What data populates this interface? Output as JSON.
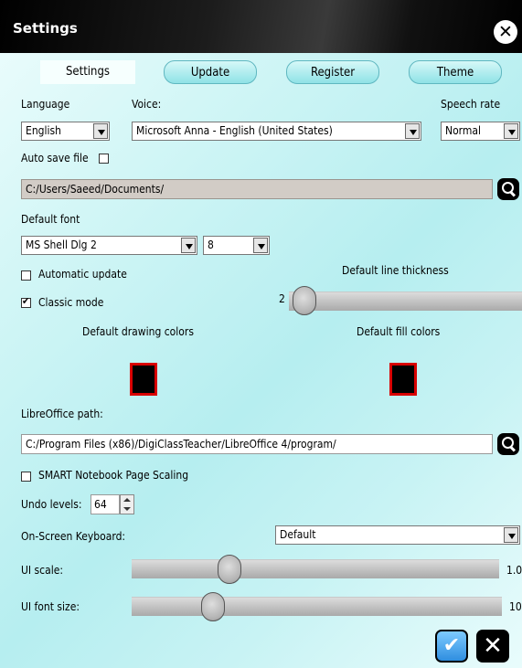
{
  "window": {
    "title": "Settings"
  },
  "tabs": [
    {
      "label": "Settings",
      "active": true
    },
    {
      "label": "Update",
      "active": false
    },
    {
      "label": "Register",
      "active": false
    },
    {
      "label": "Theme",
      "active": false
    }
  ],
  "language": {
    "label": "Language",
    "value": "English"
  },
  "voice": {
    "label": "Voice:",
    "value": "Microsoft Anna - English (United States)"
  },
  "speech_rate": {
    "label": "Speech rate",
    "value": "Normal"
  },
  "autosave": {
    "label": "Auto save file",
    "checked": false,
    "path": "C:/Users/Saeed/Documents/"
  },
  "default_font": {
    "label": "Default font",
    "family": "MS Shell Dlg 2",
    "size": "8"
  },
  "automatic_update": {
    "label": "Automatic update",
    "checked": false
  },
  "classic_mode": {
    "label": "Classic mode",
    "checked": true
  },
  "line_thickness": {
    "label": "Default line thickness",
    "value": "2"
  },
  "drawing_colors": {
    "label": "Default drawing colors",
    "color": "#000000"
  },
  "fill_colors": {
    "label": "Default fill colors",
    "color": "#000000"
  },
  "libreoffice": {
    "label": "LibreOffice path:",
    "path": "C:/Program Files (x86)/DigiClassTeacher/LibreOffice 4/program/"
  },
  "smart_scaling": {
    "label": "SMART Notebook Page Scaling",
    "checked": false
  },
  "undo_levels": {
    "label": "Undo levels:",
    "value": "64"
  },
  "osk": {
    "label": "On-Screen Keyboard:",
    "value": "Default"
  },
  "ui_scale": {
    "label": "UI scale:",
    "value_text": "1.0",
    "position": 0.25
  },
  "ui_font_size": {
    "label": "UI font size:",
    "value_text": "10",
    "position": 0.2
  },
  "icons": {
    "close": "close-icon",
    "search": "search-icon",
    "ok": "checkmark-icon",
    "cancel": "x-icon"
  },
  "colors": {
    "accent": "#2f8ee0",
    "swatch_border": "#d80000"
  }
}
